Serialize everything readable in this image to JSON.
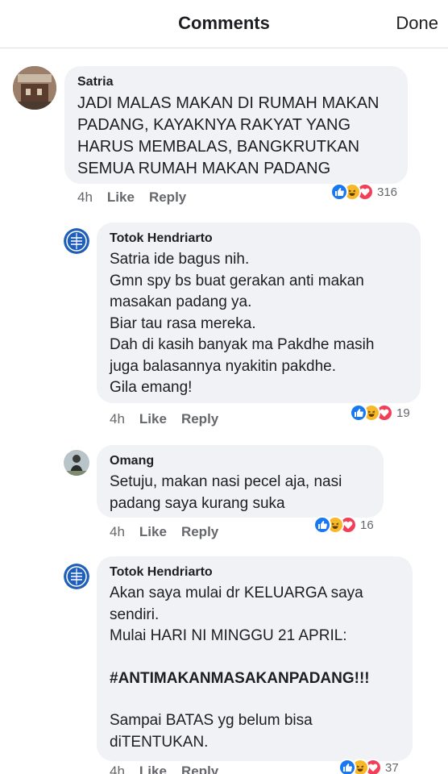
{
  "header": {
    "title": "Comments",
    "done_label": "Done"
  },
  "colors": {
    "like": "#1877f2",
    "haha": "#f7b928",
    "love": "#f33e58",
    "bubble": "#f0f2f5",
    "meta": "#65676b"
  },
  "comments": [
    {
      "author": "Satria",
      "text": "JADI MALAS MAKAN DI RUMAH MAKAN\nPADANG, KAYAKNYA RAKYAT YANG\nHARUS MEMBALAS, BANGKRUTKAN\nSEMUA RUMAH MAKAN PADANG",
      "time": "4h",
      "like_label": "Like",
      "reply_label": "Reply",
      "reaction_count": "316",
      "reactions": [
        "like-icon",
        "haha-icon",
        "love-icon"
      ]
    },
    {
      "author": "Totok Hendriarto",
      "text": "Satria ide bagus nih.\nGmn spy bs buat gerakan anti makan\nmasakan padang ya.\nBiar tau rasa mereka.\nDah di kasih banyak ma Pakdhe masih\njuga balasannya nyakitin pakdhe.\nGila emang!",
      "time": "4h",
      "like_label": "Like",
      "reply_label": "Reply",
      "reaction_count": "19",
      "reactions": [
        "like-icon",
        "haha-icon",
        "love-icon"
      ]
    },
    {
      "author": "Omang",
      "text": "Setuju, makan nasi pecel aja, nasi\npadang saya kurang suka",
      "time": "4h",
      "like_label": "Like",
      "reply_label": "Reply",
      "reaction_count": "16",
      "reactions": [
        "like-icon",
        "haha-icon",
        "love-icon"
      ]
    },
    {
      "author": "Totok Hendriarto",
      "text_1": "Akan saya mulai dr KELUARGA saya\nsendiri.\nMulai HARI NI MINGGU 21 APRIL:",
      "hashtag": "#ANTIMAKANMASAKANPADANG!!!",
      "text_2": "Sampai BATAS yg belum bisa\ndiTENTUKAN.",
      "time": "4h",
      "like_label": "Like",
      "reply_label": "Reply",
      "reaction_count": "37",
      "reactions": [
        "like-icon",
        "haha-icon",
        "love-icon"
      ]
    }
  ]
}
